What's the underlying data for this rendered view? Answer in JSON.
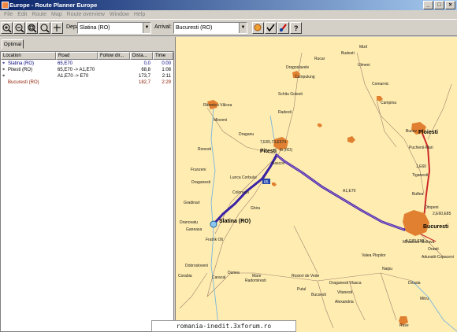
{
  "window": {
    "title": "Europe - Route Planner Europe",
    "buttons": {
      "minimize": "_",
      "maximize": "□",
      "close": "×"
    }
  },
  "menu": [
    "File",
    "Edit",
    "Route",
    "Map",
    "Route overview",
    "Window",
    "Help"
  ],
  "toolbar": {
    "departure_label": "Departure:",
    "departure_value": "Slatina (RO)",
    "arrival_label": "Arrival:",
    "arrival_value": "Bucuresti (RO)"
  },
  "tab": {
    "label": "Optimal"
  },
  "table": {
    "columns": [
      "Location",
      "Road",
      "Follow dir...",
      "Dista...",
      "Time"
    ],
    "rows": [
      {
        "location": "Slatina (RO)",
        "road": "65,E70",
        "follow": "",
        "distance": "0,0",
        "time": "0:00"
      },
      {
        "location": "Pitesti (RO)",
        "road": "65,E70 -> A1,E70",
        "follow": "",
        "distance": "68,8",
        "time": "1:08"
      },
      {
        "location": "",
        "road": "A1,E70 -> E70",
        "follow": "",
        "distance": "173,7",
        "time": "2:11"
      },
      {
        "location": "Bucuresti (RO)",
        "road": "",
        "follow": "",
        "distance": "182,7",
        "time": "2:29"
      }
    ]
  },
  "map": {
    "major_towns": {
      "pitesti": "Pitesti",
      "slatina": "Slatina (RO)",
      "pitesti_ro": "tti (RO)",
      "ploiesti": "Ploiesti",
      "bucuresti": "Bucuresti"
    },
    "towns": {
      "rucar": "Rucar",
      "dragoslavele": "Dragoslavele",
      "campulung": "Campulung",
      "schitu": "Schitu Golesti",
      "radesti": "Radesti",
      "buzesti": "Budesti",
      "mizil": "Mizil",
      "vlasia": "Ulmeni",
      "urziceni": "Urziceni",
      "rmvalcea": "Râmnicu Vâlcea",
      "mioveni": "Mioveni",
      "draganu": "Draganu",
      "e574": "7,E65,73,E574",
      "brezoi": "Ronesti",
      "bascov": "Bascov",
      "frunzeni": "Frunzeni",
      "draganesti": "Draganesti",
      "lunca": "Lunca Corbului",
      "colonesti": "Colonesti",
      "gradinari": "Gradinari",
      "ghiru": "Ghiru",
      "dranovatu": "Dranovatu",
      "ganeasa": "Ganeasa",
      "fratrik": "Fratrik Olt",
      "dobrosloveni": "Dobrosloveni",
      "caracal": "Caracal",
      "dunea": "Dunea",
      "rosiori": "Rosiori de Vede",
      "radomiresti": "Radomiresti",
      "draganesti2": "Draganesti Vlasca",
      "vitanesti": "Vitanesti",
      "alexandria": "Alexandria",
      "ruse": "Ruse",
      "bucov": "Bucov",
      "puchenii": "Puchenii-Mari",
      "tiganesti": "Tiganesti",
      "otopeni": "Otopeni",
      "e85": "2,E60,E85",
      "mihailesti": "Mihailesti",
      "bulgaria": "Bellava",
      "oraeti": "Oraeti",
      "valea": "Valea Plopilor",
      "naipu": "Naipu",
      "adunatii": "Adunatii-Copaceni",
      "comarnic": "Comarnic",
      "campina": "Campina",
      "a1e70": "A1,E70",
      "e70": "5,E70,E82",
      "e81": "1,E60",
      "bezdead": "Comana",
      "patu": "Putul",
      "bucesti": "Bucsesti",
      "crihala": "Drisala",
      "corabia": "Corabia",
      "bucuresti_e": "Buftea",
      "mare": "Mare",
      "giurgiu": "Mitru",
      "road65": "65"
    }
  },
  "watermark": "romania-inedit.3xforum.ro",
  "colors": {
    "route": "#3a22a6",
    "highway": "#cc2b2b",
    "city": "#e08030",
    "river": "#7ab6e0",
    "map_bg": "#ffecb0"
  }
}
